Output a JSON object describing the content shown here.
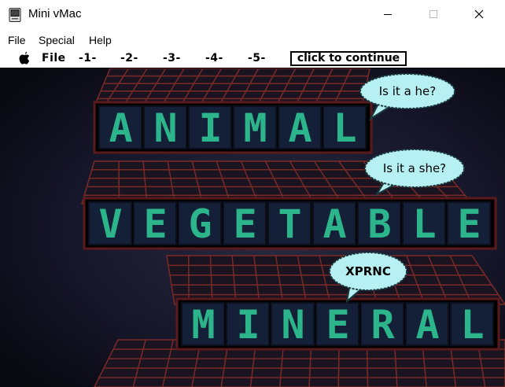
{
  "window": {
    "title": "Mini vMac",
    "menu": [
      "File",
      "Special",
      "Help"
    ]
  },
  "mac_menubar": {
    "items": [
      "File",
      "-1-",
      "-2-",
      "-3-",
      "-4-",
      "-5-"
    ],
    "continue_label": "click to continue"
  },
  "scene": {
    "words": [
      "ANIMAL",
      "VEGETABLE",
      "MINERAL"
    ],
    "bubbles": [
      "Is it a he?",
      "Is it a she?",
      "XPRNC"
    ],
    "colors": {
      "letter": "#2cb58b",
      "tile": "#142038",
      "tile_border": "#5a1a1c",
      "grid": "#7a2a26",
      "bubble": "#b6f0f2"
    }
  }
}
